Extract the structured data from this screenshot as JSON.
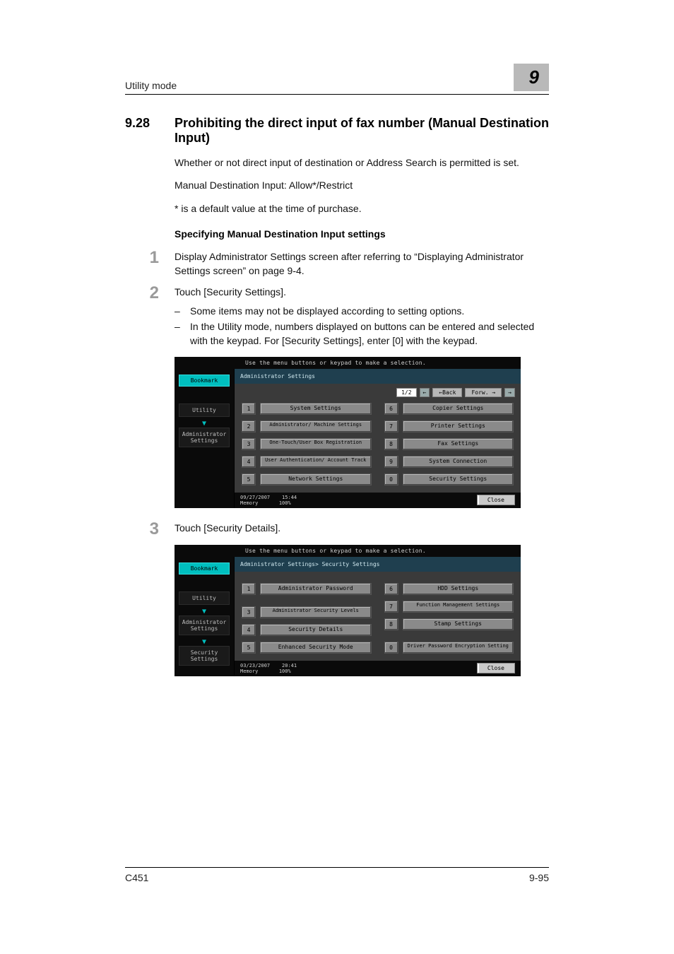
{
  "header": {
    "running_head": "Utility mode",
    "chapter_number": "9"
  },
  "section": {
    "number": "9.28",
    "title": "Prohibiting the direct input of fax number (Manual Destination Input)",
    "paragraphs": [
      "Whether or not direct input of destination or Address Search is permitted is set.",
      "Manual Destination Input: Allow*/Restrict",
      "* is a default value at the time of purchase."
    ]
  },
  "subhead": "Specifying Manual Destination Input settings",
  "steps": [
    {
      "n": "1",
      "text": "Display Administrator Settings screen after referring to “Displaying Administrator Settings screen” on page 9-4."
    },
    {
      "n": "2",
      "text": "Touch [Security Settings].",
      "sub": [
        "Some items may not be displayed according to setting options.",
        "In the Utility mode, numbers displayed on buttons can be entered and selected with the keypad. For [Security Settings], enter [0] with the keypad."
      ]
    },
    {
      "n": "3",
      "text": "Touch [Security Details]."
    }
  ],
  "panel_common": {
    "instruction": "Use the menu buttons or keypad to make a selection.",
    "bookmark": "Bookmark",
    "close": "Close"
  },
  "panel1": {
    "crumb": "Administrator Settings",
    "side_crumbs": [
      "Utility",
      "Administrator Settings"
    ],
    "pager_page": "1/2",
    "pager_back": "←Back",
    "pager_fwd": "Forw. →",
    "left": [
      {
        "n": "1",
        "label": "System Settings"
      },
      {
        "n": "2",
        "label": "Administrator/ Machine Settings",
        "two": true
      },
      {
        "n": "3",
        "label": "One-Touch/User Box Registration",
        "two": true
      },
      {
        "n": "4",
        "label": "User Authentication/ Account Track",
        "two": true
      },
      {
        "n": "5",
        "label": "Network Settings"
      }
    ],
    "right": [
      {
        "n": "6",
        "label": "Copier Settings"
      },
      {
        "n": "7",
        "label": "Printer Settings"
      },
      {
        "n": "8",
        "label": "Fax Settings"
      },
      {
        "n": "9",
        "label": "System Connection"
      },
      {
        "n": "0",
        "label": "Security Settings"
      }
    ],
    "foot_date": "09/27/2007",
    "foot_time": "15:44",
    "foot_mem_label": "Memory",
    "foot_mem_val": "100%"
  },
  "panel2": {
    "crumb": "Administrator Settings> Security Settings",
    "side_crumbs": [
      "Utility",
      "Administrator Settings",
      "Security Settings"
    ],
    "left": [
      {
        "n": "1",
        "label": "Administrator Password"
      },
      {
        "n": "",
        "label": "",
        "blank": true
      },
      {
        "n": "3",
        "label": "Administrator Security Levels",
        "two": true
      },
      {
        "n": "4",
        "label": "Security Details"
      },
      {
        "n": "5",
        "label": "Enhanced Security Mode"
      }
    ],
    "right": [
      {
        "n": "6",
        "label": "HDD Settings"
      },
      {
        "n": "7",
        "label": "Function Management Settings",
        "two": true
      },
      {
        "n": "8",
        "label": "Stamp Settings"
      },
      {
        "n": "",
        "label": "",
        "blank": true
      },
      {
        "n": "0",
        "label": "Driver Password Encryption Setting",
        "two": true
      }
    ],
    "foot_date": "03/23/2007",
    "foot_time": "20:41",
    "foot_mem_label": "Memory",
    "foot_mem_val": "100%"
  },
  "footer": {
    "model": "C451",
    "page": "9-95"
  }
}
